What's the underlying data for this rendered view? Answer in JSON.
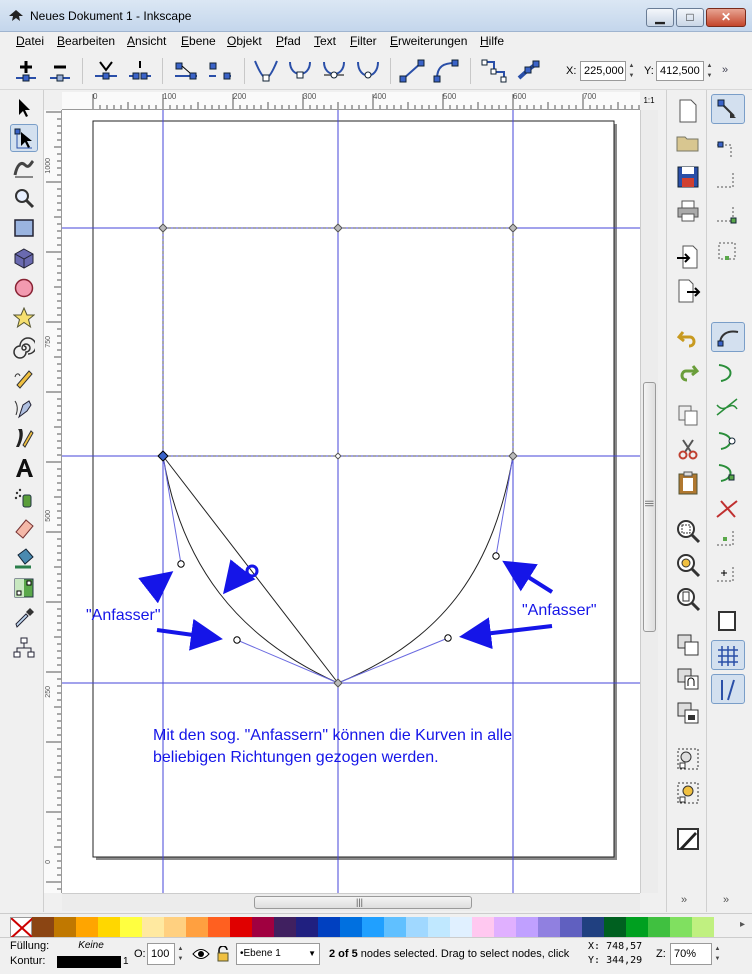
{
  "window": {
    "title": "Neues Dokument 1 - Inkscape",
    "min_glyph": "▁",
    "max_glyph": "□",
    "close_glyph": "✕"
  },
  "menu": {
    "items": [
      "Datei",
      "Bearbeiten",
      "Ansicht",
      "Ebene",
      "Objekt",
      "Pfad",
      "Text",
      "Filter",
      "Erweiterungen",
      "Hilfe"
    ]
  },
  "toolbar": {
    "x_label": "X:",
    "x_value": "225,000",
    "y_label": "Y:",
    "y_value": "412,500",
    "more": "»"
  },
  "ruler": {
    "h_labels": [
      "0",
      "100",
      "200",
      "300",
      "400",
      "500",
      "600",
      "700"
    ],
    "v_labels": [
      "1000",
      "750",
      "500",
      "250",
      "0"
    ],
    "zoom_corner": "1:1"
  },
  "canvas": {
    "annotation_left": "\"Anfasser\"",
    "annotation_right": "\"Anfasser\"",
    "caption_line1": "Mit den sog. \"Anfassern\" können die Kurven in alle",
    "caption_line2": "beliebigen Richtungen gezogen werden.",
    "annotation_color": "#1515e8",
    "guide_color": "#4545d8"
  },
  "scroll": {
    "grip": "|||",
    "grip_h": "|||"
  },
  "palette": {
    "colors": [
      "#8b4513",
      "#c07800",
      "#ffa500",
      "#ffd700",
      "#ffff40",
      "#ffe9a0",
      "#ffd080",
      "#ffa040",
      "#ff6020",
      "#e00000",
      "#a00040",
      "#402060",
      "#202080",
      "#0040c0",
      "#0070e0",
      "#20a0ff",
      "#60c0ff",
      "#a0d8ff",
      "#c0e8ff",
      "#e0f0ff",
      "#ffc8f0",
      "#e0b0ff",
      "#c0a0ff",
      "#9080e0",
      "#6060c0",
      "#204080",
      "#006020",
      "#00a020",
      "#40c040",
      "#80e060",
      "#c0f080"
    ]
  },
  "status": {
    "fill_label": "Füllung:",
    "fill_value": "Keine",
    "stroke_label": "Kontur:",
    "stroke_width": "1",
    "opacity_label": "O:",
    "opacity_value": "100",
    "layer_value": "•Ebene 1",
    "message_bold": "2 of 5",
    "message": " nodes selected. Drag to select nodes, click",
    "x_label": "X:",
    "x_value": "748,57",
    "y_label": "Y:",
    "y_value": "344,29",
    "zoom_label": "Z:",
    "zoom_value": "70%"
  }
}
